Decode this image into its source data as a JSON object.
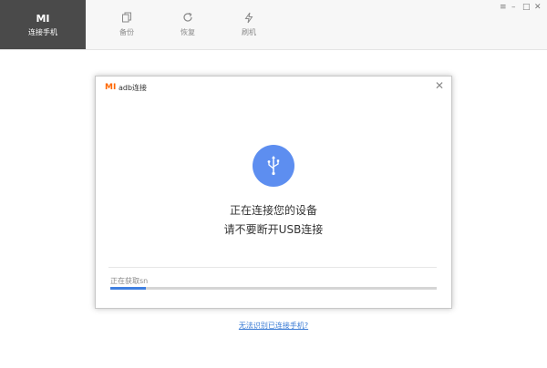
{
  "app": {
    "logo_text": "MI",
    "accent_color": "#ff6700",
    "brand_blue": "#5d8ef0"
  },
  "nav": {
    "items": [
      {
        "label": "连接手机",
        "icon": "mi-logo",
        "active": true
      },
      {
        "label": "备份",
        "icon": "copy-icon",
        "active": false
      },
      {
        "label": "恢复",
        "icon": "refresh-icon",
        "active": false
      },
      {
        "label": "刷机",
        "icon": "lightning-icon",
        "active": false
      }
    ]
  },
  "window_controls": {
    "menu": "≡",
    "minimize": "–",
    "maximize": "□",
    "close": "✕"
  },
  "dialog": {
    "logo": "MI",
    "title": "adb连接",
    "close": "✕",
    "icon": "usb-icon",
    "message_line1": "正在连接您的设备",
    "message_line2": "请不要断开USB连接",
    "status_text": "正在获取sn",
    "progress": 0.11
  },
  "help_link": "无法识别已连接手机?"
}
